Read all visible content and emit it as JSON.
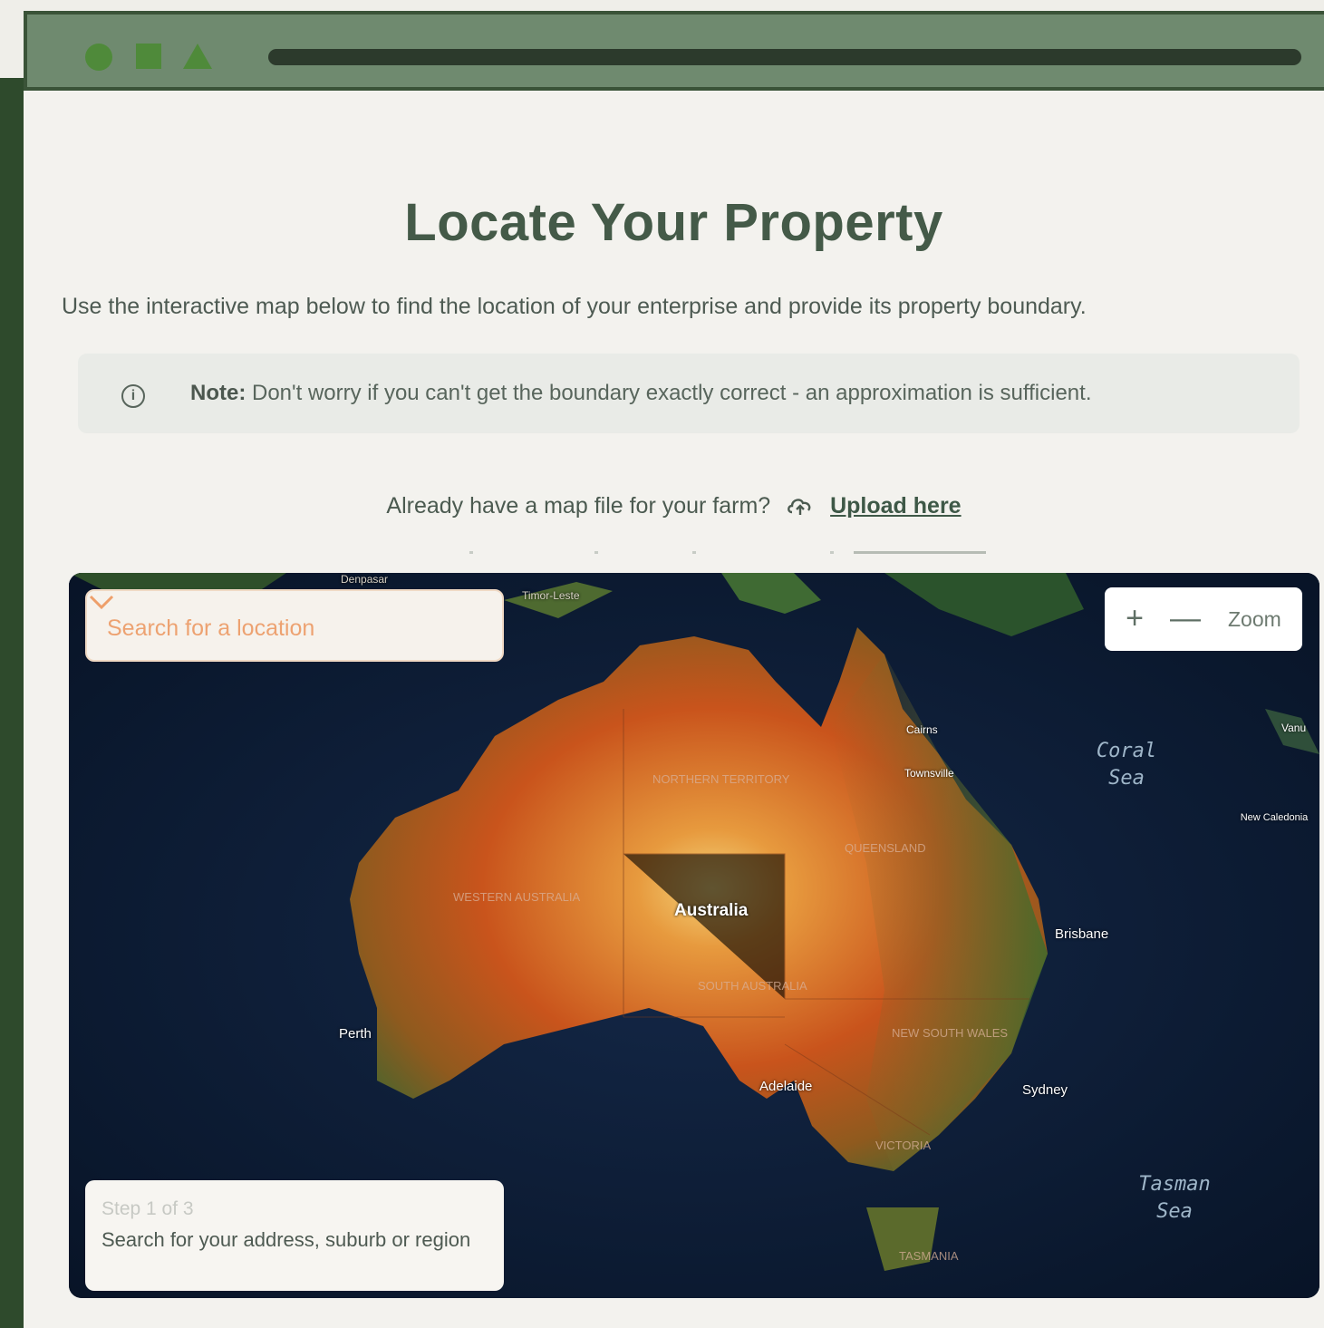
{
  "page": {
    "title": "Locate Your Property",
    "subtitle": "Use the interactive map below to find the location of your enterprise and provide its property boundary.",
    "note_label": "Note:",
    "note_text": " Don't worry if you can't get the boundary exactly correct - an approximation is sufficient.",
    "upload_prompt": "Already have a map file for your farm?",
    "upload_link": "Upload here"
  },
  "map": {
    "search_placeholder": "Search for a location",
    "zoom_in": "+",
    "zoom_out": "—",
    "zoom_label": "Zoom",
    "step_count": "Step 1 of 3",
    "step_text": "Search for your address, suburb or region",
    "labels": {
      "australia": "Australia",
      "perth": "Perth",
      "adelaide": "Adelaide",
      "sydney": "Sydney",
      "brisbane": "Brisbane",
      "cairns": "Cairns",
      "townsville": "Townsville",
      "denpasar": "Denpasar",
      "timor_leste": "Timor-Leste",
      "new_caledonia": "New Caledonia",
      "vanuatu": "Vanu",
      "coral_sea": "Coral\nSea",
      "tasman_sea": "Tasman\nSea",
      "northern_territory": "NORTHERN TERRITORY",
      "western_australia": "WESTERN AUSTRALIA",
      "queensland": "QUEENSLAND",
      "south_australia": "SOUTH AUSTRALIA",
      "new_south_wales": "NEW SOUTH WALES",
      "victoria": "VICTORIA",
      "tasmania": "TASMANIA"
    }
  },
  "icons": {
    "info": "info-icon",
    "upload": "cloud-upload-icon",
    "dropdown": "chevron-down-icon"
  },
  "colors": {
    "accent": "#445a48",
    "search_text": "#eda271",
    "titlebar": "#6f8a6f"
  }
}
